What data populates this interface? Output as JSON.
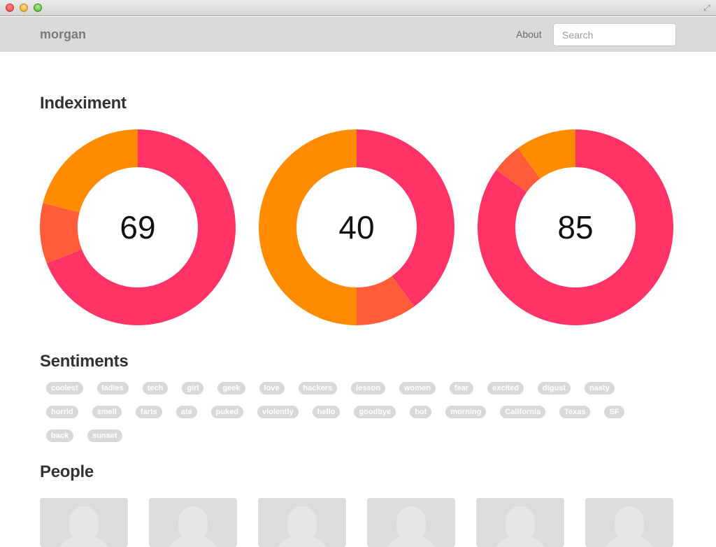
{
  "navbar": {
    "brand": "morgan",
    "about": "About",
    "search_placeholder": "Search"
  },
  "sections": {
    "indeximent": "Indeximent",
    "sentiments": "Sentiments",
    "people": "People"
  },
  "colors": {
    "pink": "#ff3366",
    "orange": "#ff8c00",
    "red_orange": "#ff5c3a"
  },
  "donuts": [
    {
      "value": "69",
      "segments": [
        {
          "color": "#ff3366",
          "fraction": 0.69
        },
        {
          "color": "#ff5c3a",
          "fraction": 0.1
        },
        {
          "color": "#ff8c00",
          "fraction": 0.21
        }
      ]
    },
    {
      "value": "40",
      "segments": [
        {
          "color": "#ff3366",
          "fraction": 0.4
        },
        {
          "color": "#ff5c3a",
          "fraction": 0.1
        },
        {
          "color": "#ff8c00",
          "fraction": 0.5
        }
      ]
    },
    {
      "value": "85",
      "segments": [
        {
          "color": "#ff3366",
          "fraction": 0.85
        },
        {
          "color": "#ff5c3a",
          "fraction": 0.05
        },
        {
          "color": "#ff8c00",
          "fraction": 0.1
        }
      ]
    }
  ],
  "tags": [
    "coolest",
    "ladies",
    "tech",
    "girl",
    "geek",
    "love",
    "hackers",
    "lesson",
    "women",
    "fear",
    "excited",
    "digust",
    "nasty",
    "horrid",
    "smell",
    "farts",
    "ate",
    "puked",
    "violently",
    "hello",
    "goodbye",
    "hot",
    "morning",
    "California",
    "Texas",
    "SF",
    "back",
    "sunset"
  ],
  "people_count_visible": 6
}
